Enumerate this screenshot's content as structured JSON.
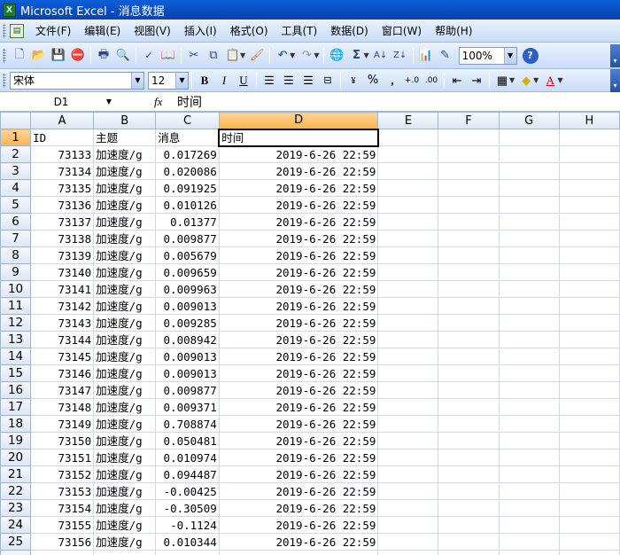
{
  "window": {
    "title": "Microsoft Excel - 消息数据"
  },
  "menu": [
    "文件(F)",
    "编辑(E)",
    "视图(V)",
    "插入(I)",
    "格式(O)",
    "工具(T)",
    "数据(D)",
    "窗口(W)",
    "帮助(H)"
  ],
  "toolbar": {
    "zoom": "100%"
  },
  "format_toolbar": {
    "font": "宋体",
    "size": "12"
  },
  "formula_bar": {
    "name_box": "D1",
    "content": "时间"
  },
  "columns": [
    "A",
    "B",
    "C",
    "D",
    "E",
    "F",
    "G",
    "H"
  ],
  "selected_cell": "D1",
  "rows": [
    {
      "n": "1",
      "a": "ID",
      "b": "主题",
      "c": "消息",
      "d": "时间",
      "header": true
    },
    {
      "n": "2",
      "a": "73133",
      "b": "加速度/g",
      "c": "0.017269",
      "d": "2019-6-26  22:59"
    },
    {
      "n": "3",
      "a": "73134",
      "b": "加速度/g",
      "c": "0.020086",
      "d": "2019-6-26  22:59"
    },
    {
      "n": "4",
      "a": "73135",
      "b": "加速度/g",
      "c": "0.091925",
      "d": "2019-6-26  22:59"
    },
    {
      "n": "5",
      "a": "73136",
      "b": "加速度/g",
      "c": "0.010126",
      "d": "2019-6-26  22:59"
    },
    {
      "n": "6",
      "a": "73137",
      "b": "加速度/g",
      "c": "0.01377",
      "d": "2019-6-26  22:59"
    },
    {
      "n": "7",
      "a": "73138",
      "b": "加速度/g",
      "c": "0.009877",
      "d": "2019-6-26  22:59"
    },
    {
      "n": "8",
      "a": "73139",
      "b": "加速度/g",
      "c": "0.005679",
      "d": "2019-6-26  22:59"
    },
    {
      "n": "9",
      "a": "73140",
      "b": "加速度/g",
      "c": "0.009659",
      "d": "2019-6-26  22:59"
    },
    {
      "n": "10",
      "a": "73141",
      "b": "加速度/g",
      "c": "0.009963",
      "d": "2019-6-26  22:59"
    },
    {
      "n": "11",
      "a": "73142",
      "b": "加速度/g",
      "c": "0.009013",
      "d": "2019-6-26  22:59"
    },
    {
      "n": "12",
      "a": "73143",
      "b": "加速度/g",
      "c": "0.009285",
      "d": "2019-6-26  22:59"
    },
    {
      "n": "13",
      "a": "73144",
      "b": "加速度/g",
      "c": "0.008942",
      "d": "2019-6-26  22:59"
    },
    {
      "n": "14",
      "a": "73145",
      "b": "加速度/g",
      "c": "0.009013",
      "d": "2019-6-26  22:59"
    },
    {
      "n": "15",
      "a": "73146",
      "b": "加速度/g",
      "c": "0.009013",
      "d": "2019-6-26  22:59"
    },
    {
      "n": "16",
      "a": "73147",
      "b": "加速度/g",
      "c": "0.009877",
      "d": "2019-6-26  22:59"
    },
    {
      "n": "17",
      "a": "73148",
      "b": "加速度/g",
      "c": "0.009371",
      "d": "2019-6-26  22:59"
    },
    {
      "n": "18",
      "a": "73149",
      "b": "加速度/g",
      "c": "0.708874",
      "d": "2019-6-26  22:59"
    },
    {
      "n": "19",
      "a": "73150",
      "b": "加速度/g",
      "c": "0.050481",
      "d": "2019-6-26  22:59"
    },
    {
      "n": "20",
      "a": "73151",
      "b": "加速度/g",
      "c": "0.010974",
      "d": "2019-6-26  22:59"
    },
    {
      "n": "21",
      "a": "73152",
      "b": "加速度/g",
      "c": "0.094487",
      "d": "2019-6-26  22:59"
    },
    {
      "n": "22",
      "a": "73153",
      "b": "加速度/g",
      "c": "-0.00425",
      "d": "2019-6-26  22:59"
    },
    {
      "n": "23",
      "a": "73154",
      "b": "加速度/g",
      "c": "-0.30509",
      "d": "2019-6-26  22:59"
    },
    {
      "n": "24",
      "a": "73155",
      "b": "加速度/g",
      "c": "-0.1124",
      "d": "2019-6-26  22:59"
    },
    {
      "n": "25",
      "a": "73156",
      "b": "加速度/g",
      "c": "0.010344",
      "d": "2019-6-26  22:59"
    }
  ]
}
